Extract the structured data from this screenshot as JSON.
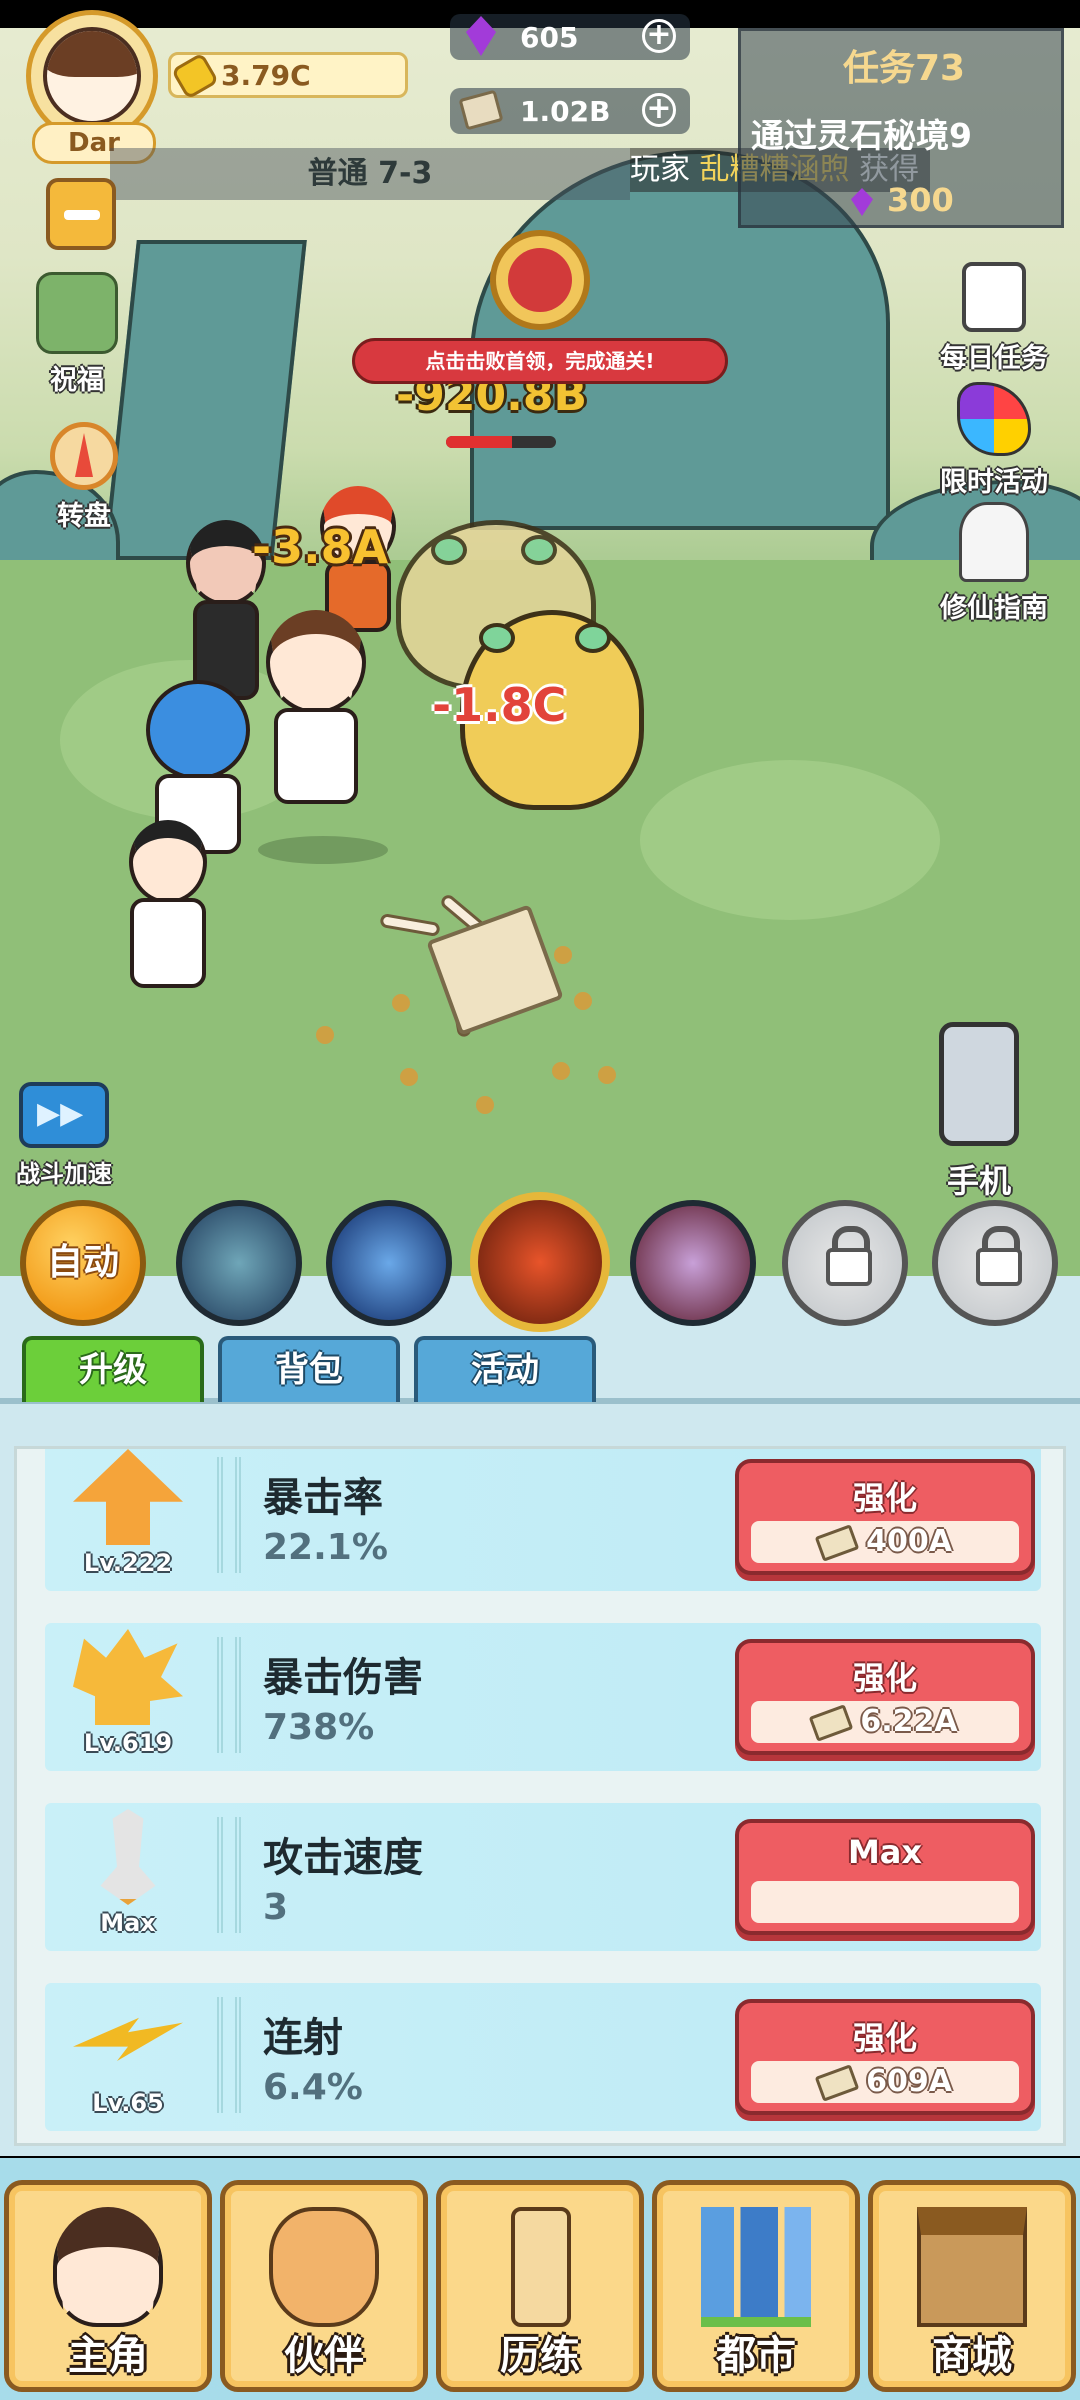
{
  "hud": {
    "player_name": "Dar",
    "gold": "3.79C",
    "gems": "605",
    "cash": "1.02B",
    "plus_symbol": "+",
    "stage": "普通 7-3",
    "news_prefix": "玩家",
    "news_player": "乱糟糟涵煦",
    "news_suffix": "获得",
    "minus_label": "",
    "colors": {
      "gold_accent": "#d59a2a",
      "gem": "#a23bd9"
    }
  },
  "task": {
    "title": "任务73",
    "description": "通过灵石秘境9",
    "reward": "300"
  },
  "left_menu": [
    {
      "label": "祝福",
      "icon": "blessing-icon"
    },
    {
      "label": "转盘",
      "icon": "wheel-icon"
    }
  ],
  "right_menu": [
    {
      "label": "每日任务",
      "icon": "daily-task-icon"
    },
    {
      "label": "限时活动",
      "icon": "limited-event-icon"
    },
    {
      "label": "修仙指南",
      "icon": "guide-icon"
    }
  ],
  "boss": {
    "banner": "点击击败首领，完成通关!",
    "damage": "-920.8B",
    "hp_fraction": 0.6
  },
  "damage_numbers": [
    "-3.8A",
    "-1.8C"
  ],
  "battle_speed_label": "战斗加速",
  "phone_label": "手机",
  "skills": {
    "auto_label": "自动",
    "items": [
      "dragon-skill-icon",
      "water-skill-icon",
      "muscle-skill-icon",
      "beast-skill-icon",
      "lock-icon",
      "lock-icon"
    ]
  },
  "tabs": [
    "升级",
    "背包",
    "活动"
  ],
  "upgrades": [
    {
      "name": "暴击率",
      "value": "22.1%",
      "level": "Lv.222",
      "button": "强化",
      "cost": "400A",
      "icon": "crit-rate-icon"
    },
    {
      "name": "暴击伤害",
      "value": "738%",
      "level": "Lv.619",
      "button": "强化",
      "cost": "6.22A",
      "icon": "crit-damage-icon"
    },
    {
      "name": "攻击速度",
      "value": "3",
      "level": "Max",
      "button": "Max",
      "cost": "",
      "icon": "attack-speed-icon"
    },
    {
      "name": "连射",
      "value": "6.4%",
      "level": "Lv.65",
      "button": "强化",
      "cost": "609A",
      "icon": "multishot-icon"
    }
  ],
  "nav": [
    {
      "label": "主角",
      "icon": "hero-icon"
    },
    {
      "label": "伙伴",
      "icon": "partner-cat-icon"
    },
    {
      "label": "历练",
      "icon": "training-sign-icon"
    },
    {
      "label": "都市",
      "icon": "city-icon"
    },
    {
      "label": "商城",
      "icon": "shop-icon"
    }
  ]
}
